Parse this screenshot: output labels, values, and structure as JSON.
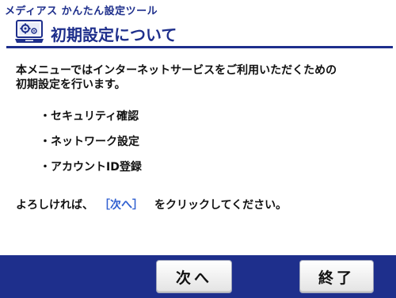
{
  "window": {
    "app_title": "メディアス かんたん設定ツール"
  },
  "header": {
    "icon": "settings-computer-icon",
    "title": "初期設定について"
  },
  "main": {
    "intro_line1": "本メニューではインターネットサービスをご利用いただくための",
    "intro_line2": "初期設定を行います。",
    "items": [
      {
        "label": "・セキュリティ確認"
      },
      {
        "label": "・ネットワーク設定"
      },
      {
        "label": "・アカウントID登録"
      }
    ],
    "instruction_prefix": "よろしければ、",
    "instruction_link": "［次へ］",
    "instruction_suffix": "をクリックしてください。"
  },
  "footer": {
    "next_label": "次へ",
    "exit_label": "終了"
  },
  "colors": {
    "brand": "#1e2f8c",
    "link": "#2f5fd0"
  }
}
